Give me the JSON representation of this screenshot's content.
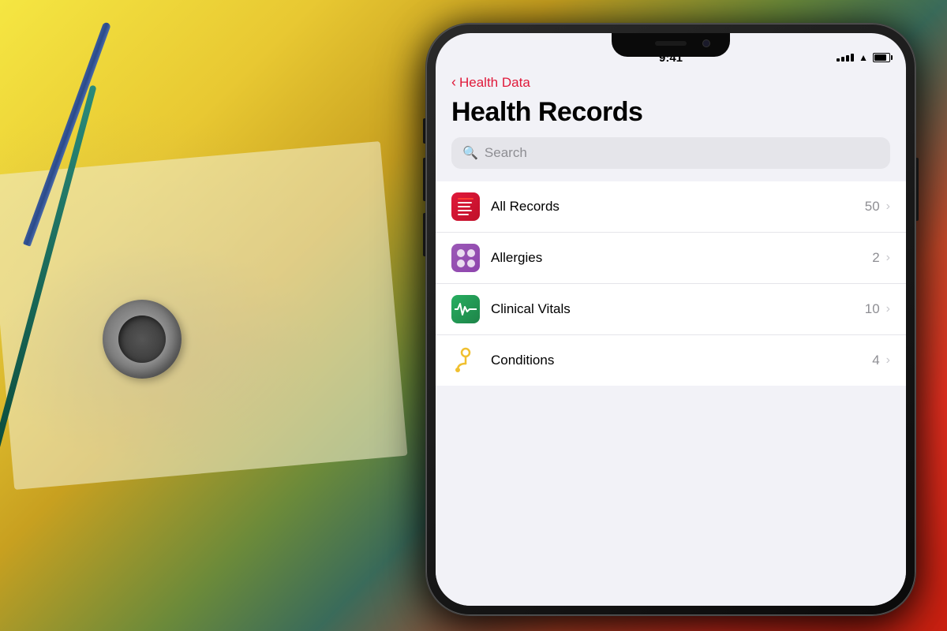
{
  "background": {
    "gradient_desc": "Yellow to green to red gradient background with stethoscope"
  },
  "phone": {
    "status_bar": {
      "time": "9:41",
      "signal_bars": 4,
      "wifi": true,
      "battery_percent": 85
    },
    "nav": {
      "back_label": "Health Data",
      "back_chevron": "‹"
    },
    "title": "Health Records",
    "search": {
      "placeholder": "Search",
      "magnifier_icon": "🔍"
    },
    "list_items": [
      {
        "id": "all-records",
        "label": "All Records",
        "count": "50",
        "icon_type": "records",
        "icon_bg": "#e0193a"
      },
      {
        "id": "allergies",
        "label": "Allergies",
        "count": "2",
        "icon_type": "allergies",
        "icon_bg": "#9b59b6"
      },
      {
        "id": "clinical-vitals",
        "label": "Clinical Vitals",
        "count": "10",
        "icon_type": "vitals",
        "icon_bg": "#27ae60"
      },
      {
        "id": "conditions",
        "label": "Conditions",
        "count": "4",
        "icon_type": "conditions",
        "icon_bg": "transparent"
      }
    ],
    "colors": {
      "accent_red": "#e0193a",
      "back_red": "#e0193a",
      "list_bg": "#ffffff",
      "screen_bg": "#f2f2f7",
      "text_primary": "#000000",
      "text_secondary": "#8e8e93",
      "chevron": "#c7c7cc"
    }
  }
}
